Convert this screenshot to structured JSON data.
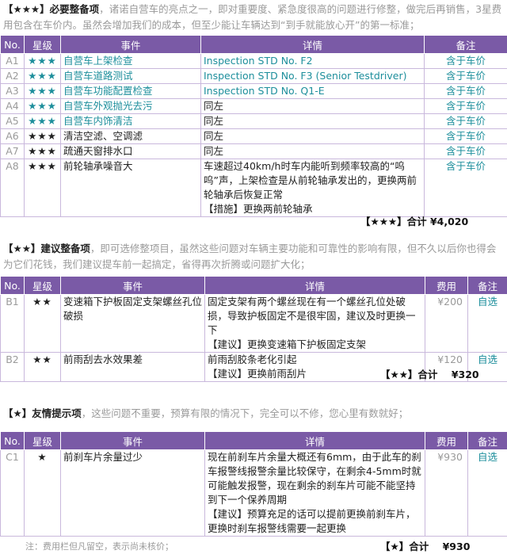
{
  "section_a": {
    "lead": "【★★★】必要整备项",
    "intro": "，诸诺自营车的亮点之一，即对重要度、紧急度很高的问题进行修整，做完后再销售，3星费用包含在车价内。虽然会增加我们的成本，但至少能让车辆达到“到手就能放心开”的第一标准；",
    "headers": [
      "No.",
      "星级",
      "事件",
      "详情",
      "备注"
    ],
    "rows": [
      {
        "no": "A1",
        "stars": "★★★",
        "event": "自营车上架检查",
        "detail": "Inspection STD No. F2",
        "note": "含于车价"
      },
      {
        "no": "A2",
        "stars": "★★★",
        "event": "自营车道路测试",
        "detail": "Inspection STD No. F3 (Senior Testdriver)",
        "note": "含于车价"
      },
      {
        "no": "A3",
        "stars": "★★★",
        "event": "自营车功能配置检查",
        "detail": "Inspection STD No. Q1-E",
        "note": "含于车价"
      },
      {
        "no": "A4",
        "stars": "★★★",
        "event": "自营车外观抛光去污",
        "detail": "同左",
        "note": "含于车价"
      },
      {
        "no": "A5",
        "stars": "★★★",
        "event": "自营车内饰清洁",
        "detail": "同左",
        "note": "含于车价"
      },
      {
        "no": "A6",
        "stars": "★★★",
        "event": "清洁空滤、空调滤",
        "detail": "同左",
        "note": "含于车价"
      },
      {
        "no": "A7",
        "stars": "★★★",
        "event": "疏通天窗排水口",
        "detail": "同左",
        "note": "含于车价"
      },
      {
        "no": "A8",
        "stars": "★★★",
        "event": "前轮轴承噪音大",
        "detail": "车速超过40km/h时车内能听到频率较高的“呜呜”声，上架检查是从前轮轴承发出的，更换两前轮轴承后恢复正常\n【措施】更换两前轮轴承",
        "note": "含于车价"
      }
    ],
    "total": "【★★★】合计 ¥4,020"
  },
  "section_b": {
    "lead": "【★★】建议整备项",
    "intro": "，即可选修整项目，虽然这些问题对车辆主要功能和可靠性的影响有限，但不久以后你也得会为它们花钱，我们建议提车前一起搞定，省得再次折腾或问题扩大化；",
    "headers": [
      "No.",
      "星级",
      "事件",
      "详情",
      "费用",
      "备注"
    ],
    "rows": [
      {
        "no": "B1",
        "stars": "★★",
        "event": "变速箱下护板固定支架螺丝孔位破损",
        "detail": "固定支架有两个螺丝现在有一个螺丝孔位处破损，导致护板固定不是很牢固，建议及时更换一下\n【建议】更换变速箱下护板固定支架",
        "fee": "¥200",
        "note": "自选"
      },
      {
        "no": "B2",
        "stars": "★★",
        "event": "前雨刮去水效果差",
        "detail": "前雨刮胶条老化引起\n【建议】更换前雨刮片",
        "fee": "¥120",
        "note": "自选"
      }
    ],
    "total": "【★★】合计    ¥320"
  },
  "section_c": {
    "lead": "【★】友情提示项",
    "intro": "，这些问题不重要，预算有限的情况下，完全可以不修，您心里有数就好；",
    "headers": [
      "No.",
      "星级",
      "事件",
      "详情",
      "费用",
      "备注"
    ],
    "rows": [
      {
        "no": "C1",
        "stars": "★",
        "event": "前刹车片余量过少",
        "detail": "现在前刹车片余量大概还有6mm，由于此车的刹车报警线报警余量比较保守，在剩余4-5mm时就可能触发报警，现在剩余的刹车片可能不能坚持到下一个保养周期\n【建议】预算充足的话可以提前更换前刹车片，更换时刹车报警线需要一起更换",
        "fee": "¥930",
        "note": "自选"
      }
    ],
    "total": "【★】合计    ¥930"
  },
  "footnote": "注：费用栏但凡留空，表示尚未核价；",
  "colors": {
    "header": "#7a5aa6",
    "teal": "#1e8f9c",
    "border": "#c9b8dc"
  }
}
